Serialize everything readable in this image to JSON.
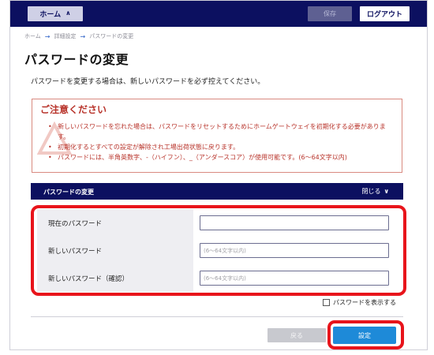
{
  "topbar": {
    "home_label": "ホーム",
    "home_chevron": "∧",
    "save_label": "保存",
    "logout_label": "ログアウト"
  },
  "breadcrumb": {
    "items": [
      "ホーム",
      "詳細設定",
      "パスワードの変更"
    ],
    "separator": "→"
  },
  "page": {
    "title": "パスワードの変更",
    "intro": "パスワードを変更する場合は、新しいパスワードを必ず控えてください。"
  },
  "notice": {
    "title": "ご注意ください",
    "items": [
      "新しいパスワードを忘れた場合は、パスワードをリセットするためにホームゲートウェイを初期化する必要があります。",
      "初期化するとすべての設定が解除され工場出荷状態に戻ります。",
      "パスワードには、半角英数字、-（ハイフン）、_（アンダースコア）が使用可能です。(6～64文字以内)"
    ]
  },
  "panel": {
    "title": "パスワードの変更",
    "close_label": "閉じる",
    "close_icon": "chevron-down-icon"
  },
  "form": {
    "rows": [
      {
        "label": "現在のパスワード",
        "value": "",
        "placeholder": ""
      },
      {
        "label": "新しいパスワード",
        "value": "",
        "placeholder": "(6～64文字以内)"
      },
      {
        "label": "新しいパスワード（確認）",
        "value": "",
        "placeholder": "(6～64文字以内)"
      }
    ],
    "show_password_label": "パスワードを表示する",
    "show_password_checked": false
  },
  "actions": {
    "back_label": "戻る",
    "set_label": "設定"
  },
  "colors": {
    "navy": "#0c1060",
    "notice_red": "#b8332a",
    "highlight_red": "#e8141b",
    "primary_blue": "#1e8ad8"
  }
}
